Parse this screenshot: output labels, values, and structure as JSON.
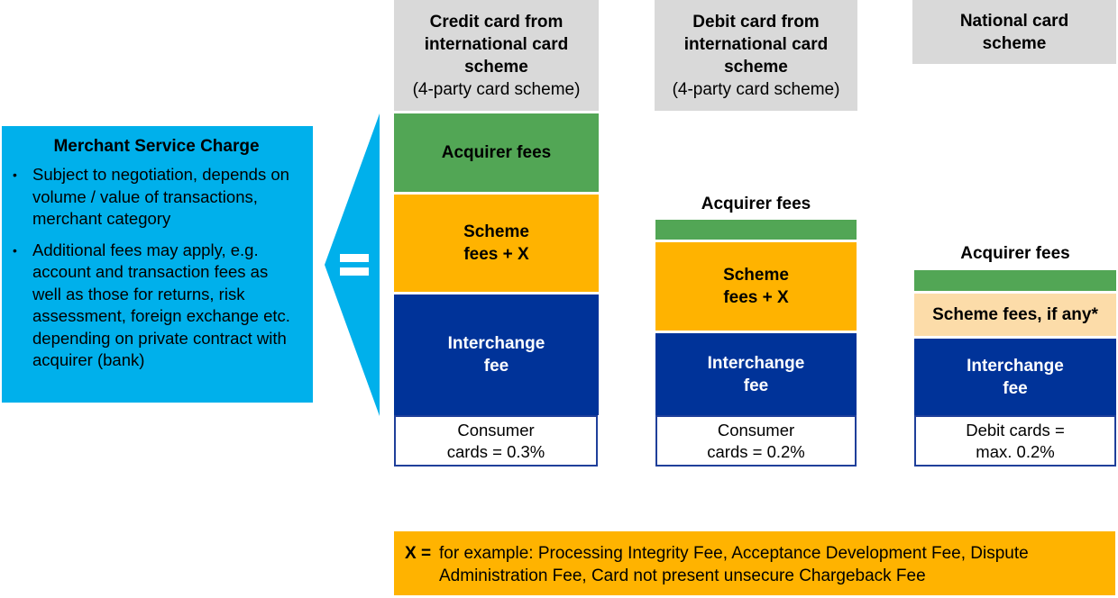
{
  "msc": {
    "title": "Merchant Service Charge",
    "bullet_glyph": "•",
    "bullets": [
      "Subject to negotiation, depends on volume / value of transactions, merchant category",
      "Additional fees may apply, e.g. account and transaction fees as well as those for returns, risk assessment, foreign exchange etc. depending on private contract with acquirer (bank)"
    ]
  },
  "connector": {
    "equals_symbol": "="
  },
  "columns": [
    {
      "header": {
        "title_lines": [
          "Credit card from",
          "international card",
          "scheme"
        ],
        "subtitle": "(4-party card scheme)"
      },
      "acquirer_fees": "Acquirer fees",
      "scheme_fees": [
        "Scheme",
        "fees + X"
      ],
      "interchange_fee": [
        "Interchange",
        "fee"
      ],
      "cap": [
        "Consumer",
        "cards  =  0.3%"
      ]
    },
    {
      "header": {
        "title_lines": [
          "Debit card from",
          "international card",
          "scheme"
        ],
        "subtitle": "(4-party card scheme)"
      },
      "acquirer_fees": "Acquirer fees",
      "scheme_fees": [
        "Scheme",
        "fees + X"
      ],
      "interchange_fee": [
        "Interchange",
        "fee"
      ],
      "cap": [
        "Consumer",
        "cards  =  0.2%"
      ]
    },
    {
      "header": {
        "title_lines": [
          "National card",
          "scheme"
        ],
        "subtitle": ""
      },
      "acquirer_fees": "Acquirer fees",
      "scheme_fees": [
        "Scheme fees, if any*"
      ],
      "interchange_fee": [
        "Interchange",
        "fee"
      ],
      "cap": [
        "Debit cards =",
        "max. 0.2%"
      ]
    }
  ],
  "footnote": {
    "key": "X =",
    "line1": "for example: Processing Integrity Fee, Acceptance Development Fee, Dispute",
    "line2": "Administration Fee, Card not present unsecure Chargeback Fee"
  },
  "colors": {
    "msc_blue": "#00B0EB",
    "header_gray": "#D9D9D9",
    "acquirer_green": "#52A655",
    "scheme_orange": "#FFB300",
    "scheme_tan": "#FCDCA9",
    "interchange_blue": "#003399"
  }
}
